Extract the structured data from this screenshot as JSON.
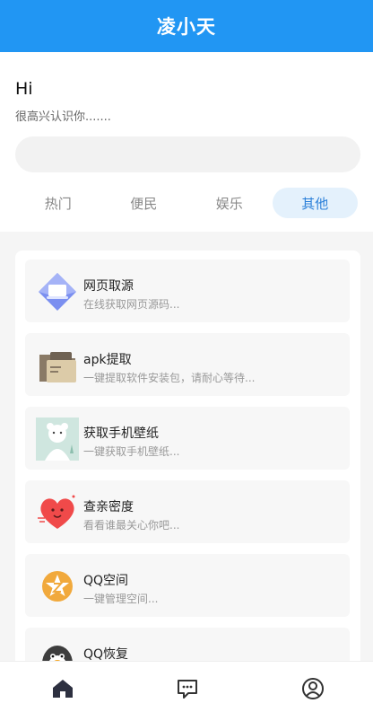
{
  "header": {
    "title": "凌小天"
  },
  "greeting": {
    "title": "Hi",
    "subtitle": "很高兴认识你......."
  },
  "search": {
    "value": "",
    "placeholder": ""
  },
  "tabs": [
    {
      "label": "热门",
      "active": false
    },
    {
      "label": "便民",
      "active": false
    },
    {
      "label": "娱乐",
      "active": false
    },
    {
      "label": "其他",
      "active": true
    }
  ],
  "items": [
    {
      "name": "网页取源",
      "desc": "在线获取网页源码...",
      "icon": "webpage-source-icon"
    },
    {
      "name": "apk提取",
      "desc": "一键提取软件安装包，请耐心等待...",
      "icon": "folder-icon"
    },
    {
      "name": "获取手机壁纸",
      "desc": "一键获取手机壁纸...",
      "icon": "wallpaper-icon"
    },
    {
      "name": "查亲密度",
      "desc": "看看谁最关心你吧...",
      "icon": "heart-icon"
    },
    {
      "name": "QQ空间",
      "desc": "一键管理空间...",
      "icon": "qzone-star-icon"
    },
    {
      "name": "QQ恢复",
      "desc": "",
      "icon": "qq-penguin-icon"
    }
  ],
  "bottom_nav": [
    {
      "icon": "home-icon",
      "active": true
    },
    {
      "icon": "message-icon",
      "active": false
    },
    {
      "icon": "profile-icon",
      "active": false
    }
  ],
  "colors": {
    "primary": "#2196f3",
    "tab_active_bg": "#e4f1fc",
    "tab_active_text": "#2a7fd9"
  }
}
